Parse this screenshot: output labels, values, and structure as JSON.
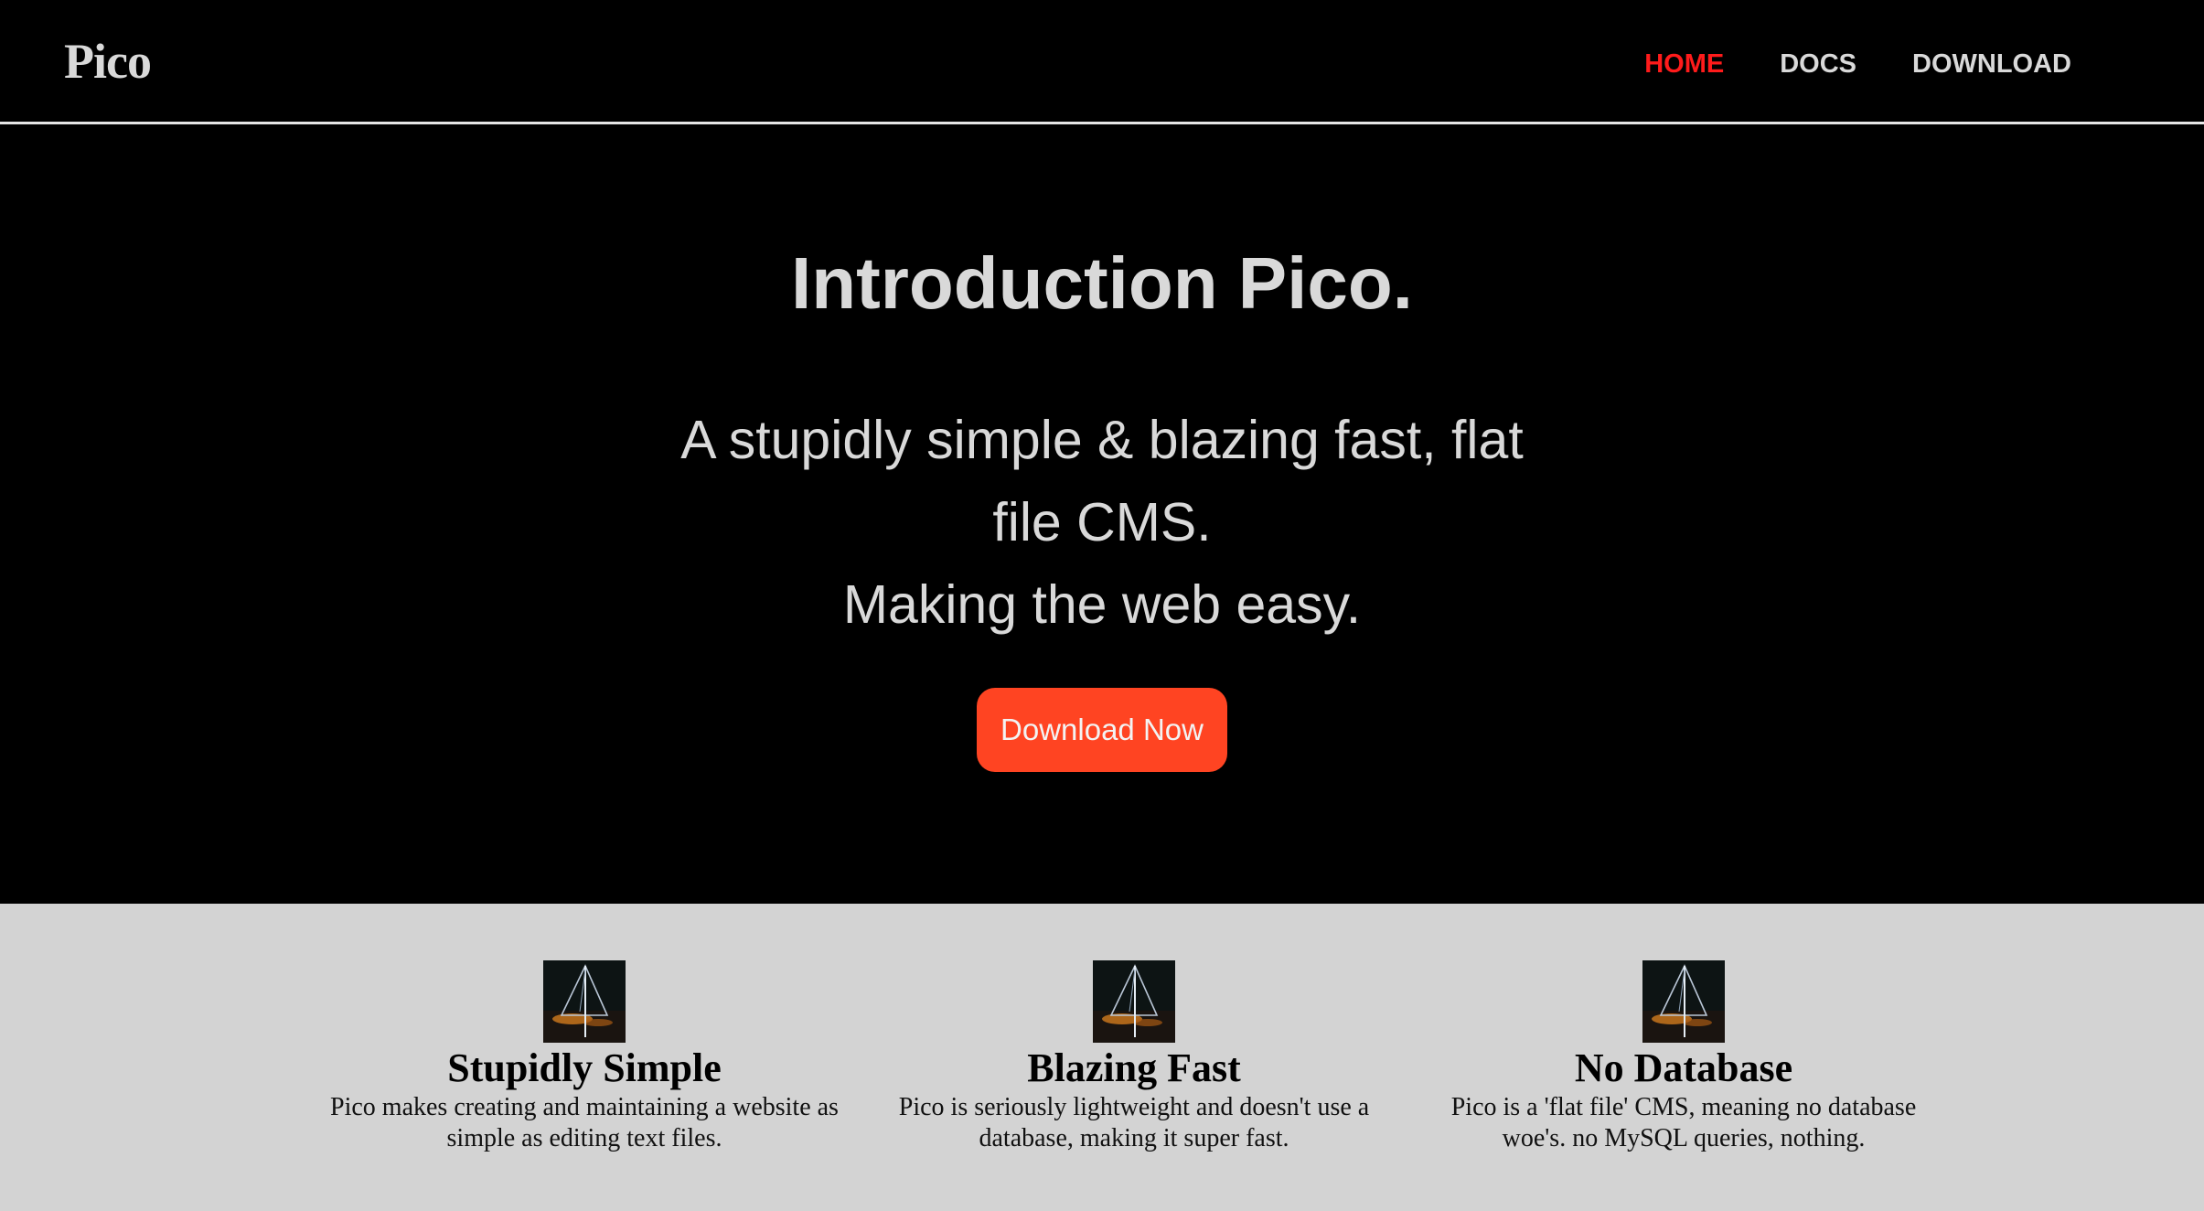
{
  "header": {
    "logo": "Pico",
    "nav": [
      {
        "label": "HOME",
        "active": true
      },
      {
        "label": "DOCS",
        "active": false
      },
      {
        "label": "DOWNLOAD",
        "active": false
      }
    ]
  },
  "hero": {
    "title": "Introduction Pico.",
    "subtitle_lines": [
      "A stupidly simple & blazing fast, flat",
      "file CMS.",
      "Making the web easy."
    ],
    "button_label": "Download Now"
  },
  "features": [
    {
      "title": "Stupidly Simple",
      "text": "Pico makes creating and maintaining a website as simple as editing text files.",
      "icon": "thumbnail-image-icon"
    },
    {
      "title": "Blazing Fast",
      "text": "Pico is seriously lightweight and doesn't use a database, making it super fast.",
      "icon": "thumbnail-image-icon"
    },
    {
      "title": "No Database",
      "text": "Pico is a 'flat file' CMS, meaning no database woe's. no MySQL queries, nothing.",
      "icon": "thumbnail-image-icon"
    }
  ],
  "colors": {
    "background": "#000000",
    "nav_active": "#ff1b1b",
    "nav_text": "#d9d9d9",
    "button": "#ff4422",
    "features_background": "#d3d3d3"
  }
}
